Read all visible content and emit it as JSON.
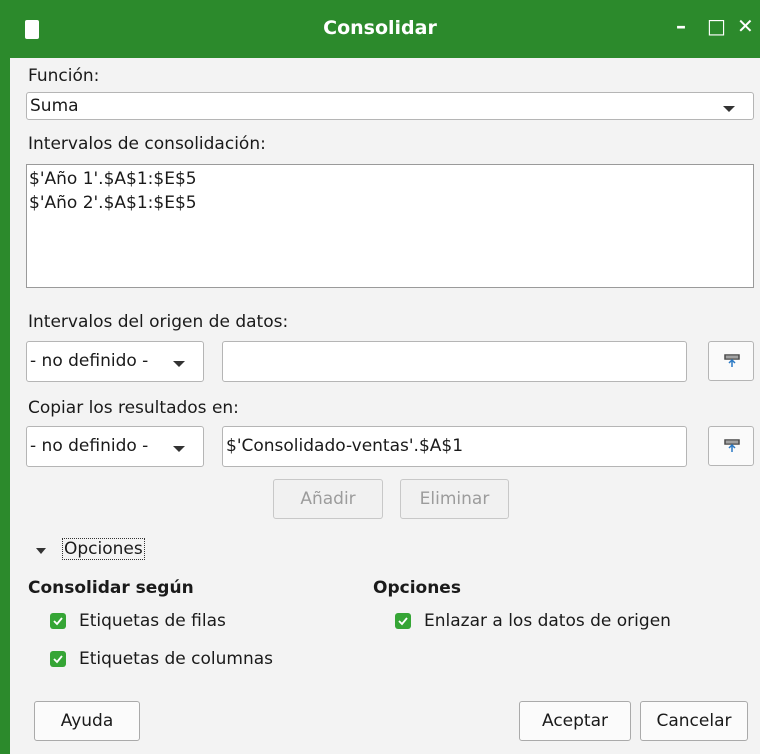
{
  "window": {
    "title": "Consolidar",
    "controls": [
      "–",
      "□",
      "✕"
    ]
  },
  "function": {
    "label": "Función:",
    "value": "Suma"
  },
  "consolidation": {
    "label": "Intervalos de consolidación:",
    "ranges": [
      "$'Año 1'.$A$1:$E$5",
      "$'Año 2'.$A$1:$E$5"
    ]
  },
  "source": {
    "label": "Intervalos del origen de datos:",
    "select_value": "- no definido -",
    "input_value": ""
  },
  "copy": {
    "label": "Copiar los resultados en:",
    "select_value": "- no definido -",
    "input_value": "$'Consolidado-ventas'.$A$1"
  },
  "buttons": {
    "add": "Añadir",
    "delete": "Eliminar",
    "help": "Ayuda",
    "ok": "Aceptar",
    "cancel": "Cancelar"
  },
  "options": {
    "expander_label": "Opciones",
    "consolidate_by_title": "Consolidar según",
    "row_labels": "Etiquetas de filas",
    "column_labels": "Etiquetas de columnas",
    "options_title": "Opciones",
    "link_source": "Enlazar a los datos de origen"
  },
  "icons": {
    "doc": "document-icon",
    "shrink": "shrink-range-icon",
    "check": "checkmark-icon"
  },
  "colors": {
    "titlebar": "#2c8a2c",
    "checkbox": "#35a535"
  }
}
